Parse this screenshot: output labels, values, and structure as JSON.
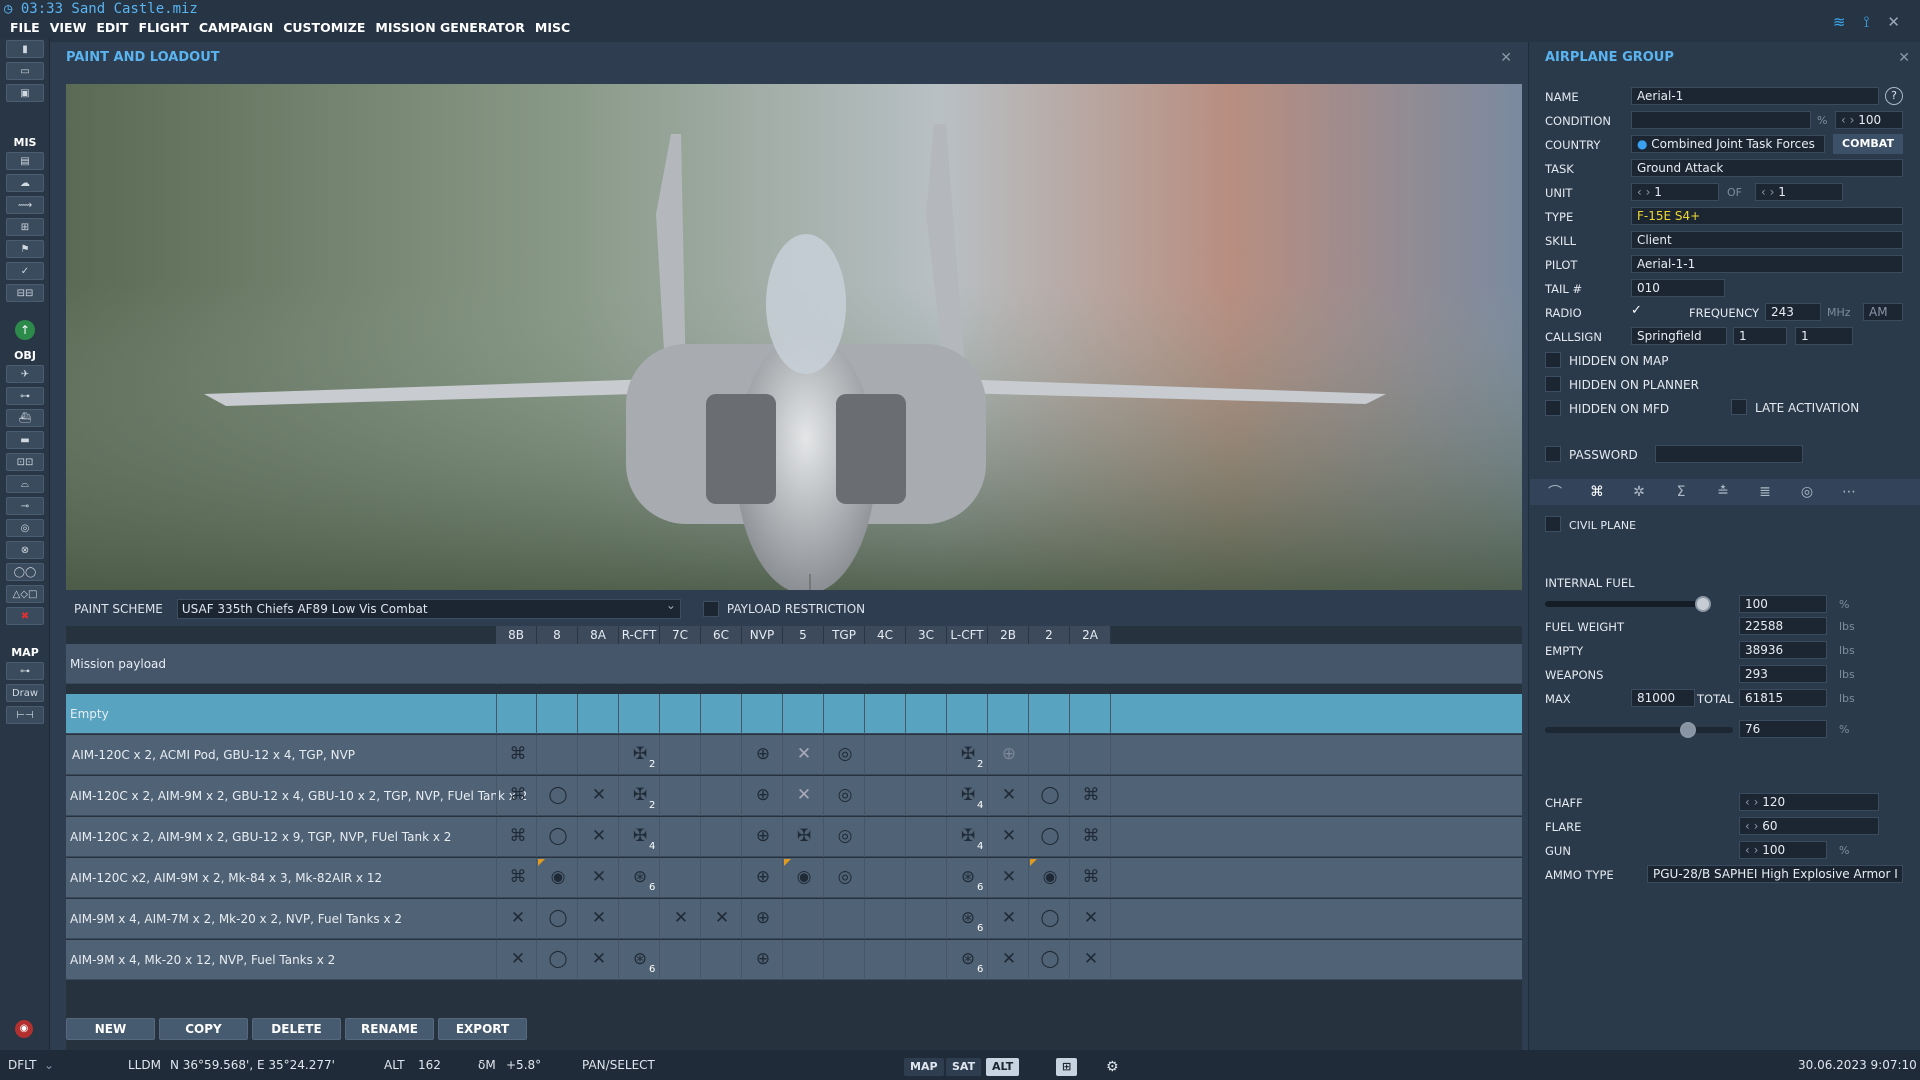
{
  "window": {
    "title": "03:33  Sand Castle.miz"
  },
  "menu": [
    "FILE",
    "VIEW",
    "EDIT",
    "FLIGHT",
    "CAMPAIGN",
    "CUSTOMIZE",
    "MISSION GENERATOR",
    "MISC"
  ],
  "toolbar": {
    "mis_label": "MIS",
    "obj_label": "OBJ",
    "map_label": "MAP",
    "draw_label": "Draw"
  },
  "paint": {
    "title": "PAINT AND LOADOUT",
    "scheme_label": "PAINT SCHEME",
    "scheme_value": "USAF 335th Chiefs AF89 Low Vis Combat",
    "payload_restriction": "PAYLOAD RESTRICTION",
    "stations": [
      "8B",
      "8",
      "8A",
      "R-CFT",
      "7C",
      "6C",
      "NVP",
      "5",
      "TGP",
      "4C",
      "3C",
      "L-CFT",
      "2B",
      "2",
      "2A"
    ],
    "mission_payload": "Mission payload",
    "rows": [
      {
        "name": "Empty"
      },
      {
        "name": "AIM-120C x 2, ACMI Pod, GBU-12 x 4,  TGP, NVP"
      },
      {
        "name": "AIM-120C x 2, AIM-9M x 2, GBU-12 x 4, GBU-10 x 2, TGP, NVP, FUel Tank x 2"
      },
      {
        "name": "AIM-120C x 2, AIM-9M x 2, GBU-12 x 9, TGP, NVP, FUel Tank x 2"
      },
      {
        "name": "AIM-120C x2, AIM-9M x 2, Mk-84 x 3, Mk-82AIR x 12"
      },
      {
        "name": "AIM-9M x 4, AIM-7M x 2, Mk-20 x 2, NVP, Fuel Tanks x 2"
      },
      {
        "name": "AIM-9M x 4, Mk-20 x 12, NVP, Fuel Tanks x 2"
      }
    ],
    "buttons": {
      "new": "NEW",
      "copy": "COPY",
      "delete": "DELETE",
      "rename": "RENAME",
      "export": "EXPORT"
    }
  },
  "group": {
    "title": "AIRPLANE GROUP",
    "name_label": "NAME",
    "name": "Aerial-1",
    "condition_label": "CONDITION",
    "condition": "100",
    "pct": "%",
    "country_label": "COUNTRY",
    "country": "Combined Joint Task Forces",
    "combat": "COMBAT",
    "task_label": "TASK",
    "task": "Ground Attack",
    "unit_label": "UNIT",
    "unit": "1",
    "of": "OF",
    "unit_of": "1",
    "type_label": "TYPE",
    "type": "F-15E S4+",
    "skill_label": "SKILL",
    "skill": "Client",
    "pilot_label": "PILOT",
    "pilot": "Aerial-1-1",
    "tail_label": "TAIL #",
    "tail": "010",
    "radio_label": "RADIO",
    "freq_label": "FREQUENCY",
    "freq": "243",
    "mhz": "MHz",
    "am": "AM",
    "callsign_label": "CALLSIGN",
    "callsign": "Springfield",
    "cs1": "1",
    "cs2": "1",
    "hidden_map": "HIDDEN ON MAP",
    "hidden_planner": "HIDDEN ON PLANNER",
    "hidden_mfd": "HIDDEN ON MFD",
    "late_activation": "LATE ACTIVATION",
    "password": "PASSWORD",
    "civil_plane": "CIVIL PLANE",
    "internal_fuel_label": "INTERNAL FUEL",
    "internal_fuel": "100",
    "internal_fuel_level": 1.0,
    "fuel_weight_label": "FUEL WEIGHT",
    "fuel_weight": "22588",
    "empty_label": "EMPTY",
    "empty": "38936",
    "weapons_label": "WEAPONS",
    "weapons": "293",
    "max_label": "MAX",
    "max": "81000",
    "total_label": "TOTAL",
    "total": "61815",
    "total_pct": "76",
    "total_level": 0.76,
    "lbs": "lbs",
    "chaff_label": "CHAFF",
    "chaff": "120",
    "flare_label": "FLARE",
    "flare": "60",
    "gun_label": "GUN",
    "gun": "100",
    "ammo_label": "AMMO TYPE",
    "ammo": "PGU-28/B SAPHEI High Explosive Armor I"
  },
  "status": {
    "profile": "DFLT",
    "coord_label": "LLDM",
    "coord": "N 36°59.568', E 35°24.277'",
    "alt_label": "ALT",
    "alt": "162",
    "dm_label": "δM",
    "dm": "+5.8°",
    "mode": "PAN/SELECT",
    "map": "MAP",
    "sat": "SAT",
    "alt_btn": "ALT",
    "datetime": "30.06.2023 9:07:10"
  }
}
